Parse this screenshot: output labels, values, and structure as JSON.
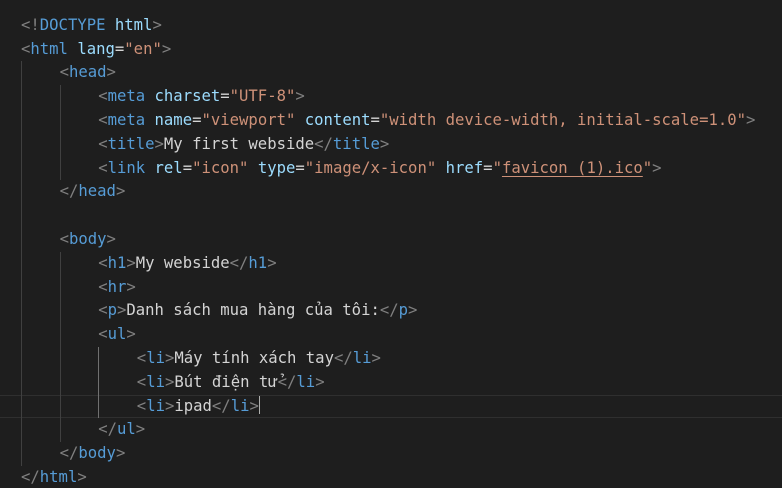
{
  "code_lines": [
    {
      "tokens": []
    },
    {
      "tokens": [
        {
          "c": "tb",
          "t": "<!"
        },
        {
          "c": "tg",
          "t": "DOCTYPE"
        },
        {
          "c": "tx",
          "t": " "
        },
        {
          "c": "at",
          "t": "html"
        },
        {
          "c": "tb",
          "t": ">"
        }
      ]
    },
    {
      "tokens": [
        {
          "c": "tb",
          "t": "<"
        },
        {
          "c": "tg",
          "t": "html"
        },
        {
          "c": "tx",
          "t": " "
        },
        {
          "c": "at",
          "t": "lang"
        },
        {
          "c": "op",
          "t": "="
        },
        {
          "c": "av",
          "t": "\"en\""
        },
        {
          "c": "tb",
          "t": ">"
        }
      ]
    },
    {
      "indent": 1,
      "tokens": [
        {
          "c": "tb",
          "t": "<"
        },
        {
          "c": "tg",
          "t": "head"
        },
        {
          "c": "tb",
          "t": ">"
        }
      ]
    },
    {
      "indent": 2,
      "tokens": [
        {
          "c": "tb",
          "t": "<"
        },
        {
          "c": "tg",
          "t": "meta"
        },
        {
          "c": "tx",
          "t": " "
        },
        {
          "c": "at",
          "t": "charset"
        },
        {
          "c": "op",
          "t": "="
        },
        {
          "c": "av",
          "t": "\"UTF-8\""
        },
        {
          "c": "tb",
          "t": ">"
        }
      ]
    },
    {
      "indent": 2,
      "tokens": [
        {
          "c": "tb",
          "t": "<"
        },
        {
          "c": "tg",
          "t": "meta"
        },
        {
          "c": "tx",
          "t": " "
        },
        {
          "c": "at",
          "t": "name"
        },
        {
          "c": "op",
          "t": "="
        },
        {
          "c": "av",
          "t": "\"viewport\""
        },
        {
          "c": "tx",
          "t": " "
        },
        {
          "c": "at",
          "t": "content"
        },
        {
          "c": "op",
          "t": "="
        },
        {
          "c": "av",
          "t": "\"width device-width, initial-scale=1.0\""
        },
        {
          "c": "tb",
          "t": ">"
        }
      ]
    },
    {
      "indent": 2,
      "tokens": [
        {
          "c": "tb",
          "t": "<"
        },
        {
          "c": "tg",
          "t": "title"
        },
        {
          "c": "tb",
          "t": ">"
        },
        {
          "c": "tx",
          "t": "My first webside"
        },
        {
          "c": "tb",
          "t": "</"
        },
        {
          "c": "tg",
          "t": "title"
        },
        {
          "c": "tb",
          "t": ">"
        }
      ]
    },
    {
      "indent": 2,
      "tokens": [
        {
          "c": "tb",
          "t": "<"
        },
        {
          "c": "tg",
          "t": "link"
        },
        {
          "c": "tx",
          "t": " "
        },
        {
          "c": "at",
          "t": "rel"
        },
        {
          "c": "op",
          "t": "="
        },
        {
          "c": "av",
          "t": "\"icon\""
        },
        {
          "c": "tx",
          "t": " "
        },
        {
          "c": "at",
          "t": "type"
        },
        {
          "c": "op",
          "t": "="
        },
        {
          "c": "av",
          "t": "\"image/x-icon\""
        },
        {
          "c": "tx",
          "t": " "
        },
        {
          "c": "at",
          "t": "href"
        },
        {
          "c": "op",
          "t": "="
        },
        {
          "c": "av",
          "t": "\""
        },
        {
          "c": "av link-val",
          "t": "favicon (1).ico"
        },
        {
          "c": "av",
          "t": "\""
        },
        {
          "c": "tb",
          "t": ">"
        }
      ]
    },
    {
      "indent": 1,
      "tokens": [
        {
          "c": "tb",
          "t": "</"
        },
        {
          "c": "tg",
          "t": "head"
        },
        {
          "c": "tb",
          "t": ">"
        }
      ]
    },
    {
      "indent": 1,
      "tokens": []
    },
    {
      "indent": 1,
      "tokens": [
        {
          "c": "tb",
          "t": "<"
        },
        {
          "c": "tg",
          "t": "body"
        },
        {
          "c": "tb",
          "t": ">"
        }
      ]
    },
    {
      "indent": 2,
      "tokens": [
        {
          "c": "tb",
          "t": "<"
        },
        {
          "c": "tg",
          "t": "h1"
        },
        {
          "c": "tb",
          "t": ">"
        },
        {
          "c": "tx",
          "t": "My webside"
        },
        {
          "c": "tb",
          "t": "</"
        },
        {
          "c": "tg",
          "t": "h1"
        },
        {
          "c": "tb",
          "t": ">"
        }
      ]
    },
    {
      "indent": 2,
      "tokens": [
        {
          "c": "tb",
          "t": "<"
        },
        {
          "c": "tg",
          "t": "hr"
        },
        {
          "c": "tb",
          "t": ">"
        }
      ]
    },
    {
      "indent": 2,
      "tokens": [
        {
          "c": "tb",
          "t": "<"
        },
        {
          "c": "tg",
          "t": "p"
        },
        {
          "c": "tb",
          "t": ">"
        },
        {
          "c": "tx",
          "t": "Danh sách mua hàng của tôi:"
        },
        {
          "c": "tb",
          "t": "</"
        },
        {
          "c": "tg",
          "t": "p"
        },
        {
          "c": "tb",
          "t": ">"
        }
      ]
    },
    {
      "indent": 2,
      "tokens": [
        {
          "c": "tb",
          "t": "<"
        },
        {
          "c": "tg",
          "t": "ul"
        },
        {
          "c": "tb",
          "t": ">"
        }
      ]
    },
    {
      "indent": 3,
      "tokens": [
        {
          "c": "tb",
          "t": "<"
        },
        {
          "c": "tg",
          "t": "li"
        },
        {
          "c": "tb",
          "t": ">"
        },
        {
          "c": "tx",
          "t": "Máy tính xách tay"
        },
        {
          "c": "tb",
          "t": "</"
        },
        {
          "c": "tg",
          "t": "li"
        },
        {
          "c": "tb",
          "t": ">"
        }
      ]
    },
    {
      "indent": 3,
      "tokens": [
        {
          "c": "tb",
          "t": "<"
        },
        {
          "c": "tg",
          "t": "li"
        },
        {
          "c": "tb",
          "t": ">"
        },
        {
          "c": "tx",
          "t": "Bút điện tử"
        },
        {
          "c": "tb",
          "t": "</"
        },
        {
          "c": "tg",
          "t": "li"
        },
        {
          "c": "tb",
          "t": ">"
        }
      ]
    },
    {
      "indent": 3,
      "current": true,
      "tokens": [
        {
          "c": "tb",
          "t": "<"
        },
        {
          "c": "tg",
          "t": "li"
        },
        {
          "c": "tb",
          "t": ">"
        },
        {
          "c": "tx",
          "t": "ipad"
        },
        {
          "c": "tb",
          "t": "</"
        },
        {
          "c": "tg",
          "t": "li"
        },
        {
          "c": "tb",
          "t": ">"
        }
      ]
    },
    {
      "indent": 2,
      "tokens": [
        {
          "c": "tb",
          "t": "</"
        },
        {
          "c": "tg",
          "t": "ul"
        },
        {
          "c": "tb",
          "t": ">"
        }
      ]
    },
    {
      "indent": 1,
      "tokens": [
        {
          "c": "tb",
          "t": "</"
        },
        {
          "c": "tg",
          "t": "body"
        },
        {
          "c": "tb",
          "t": ">"
        }
      ]
    },
    {
      "tokens": [
        {
          "c": "tb",
          "t": "</"
        },
        {
          "c": "tg",
          "t": "html"
        },
        {
          "c": "tb",
          "t": ">"
        }
      ]
    }
  ],
  "colors": {
    "background": "#1e1e1e",
    "tag": "#569cd6",
    "attribute": "#9cdcfe",
    "string": "#ce9178",
    "bracket": "#808080",
    "text": "#d4d4d4"
  }
}
